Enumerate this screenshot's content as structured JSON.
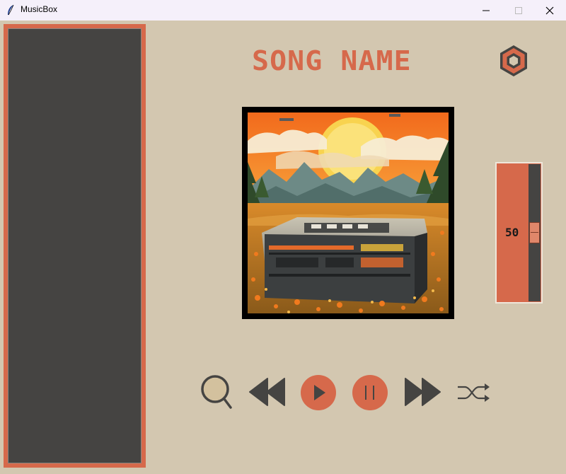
{
  "window": {
    "title": "MusicBox",
    "icons": [
      "feather-icon",
      "minimize-icon",
      "maximize-icon",
      "close-icon"
    ]
  },
  "song": {
    "title": "SONG NAME"
  },
  "volume": {
    "value": "50",
    "level": 0.5
  },
  "controls": {
    "icons": [
      "search-icon",
      "previous-icon",
      "play-icon",
      "pause-icon",
      "next-icon",
      "shuffle-icon"
    ]
  },
  "colors": {
    "background": "#d3c7b0",
    "accent": "#d6694b",
    "dark": "#454442"
  }
}
